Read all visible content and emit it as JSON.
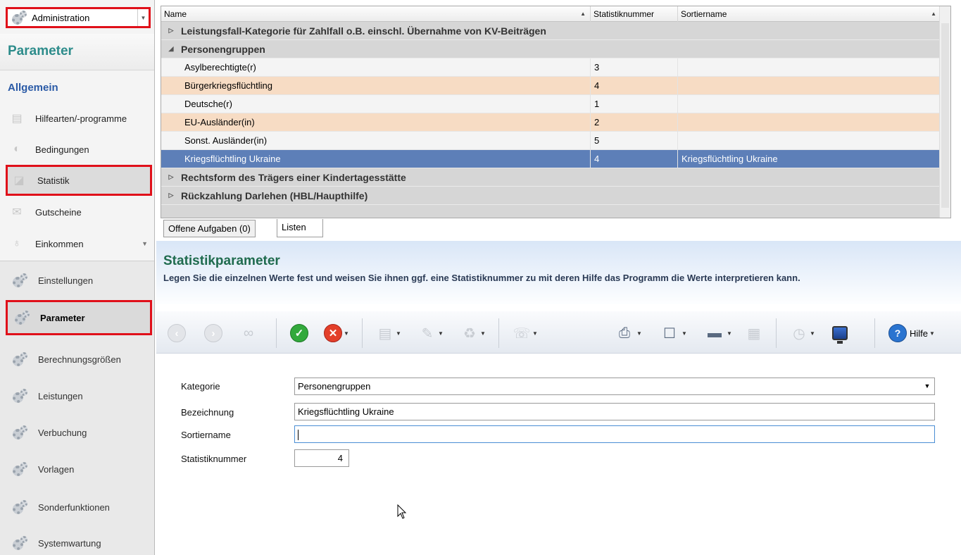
{
  "sidebar": {
    "module": "Administration",
    "header": "Parameter",
    "section": "Allgemein",
    "items": [
      {
        "label": "Hilfearten/-programme",
        "icon": "document-stack-icon"
      },
      {
        "label": "Bedingungen",
        "icon": "toggle-icon"
      },
      {
        "label": "Statistik",
        "icon": "chart-icon"
      },
      {
        "label": "Gutscheine",
        "icon": "voucher-icon"
      },
      {
        "label": "Einkommen",
        "icon": "money-bag-icon"
      }
    ],
    "groups": [
      {
        "label": "Einstellungen"
      },
      {
        "label": "Parameter"
      },
      {
        "label": "Berechnungsgrößen"
      },
      {
        "label": "Leistungen"
      },
      {
        "label": "Verbuchung"
      },
      {
        "label": "Vorlagen"
      },
      {
        "label": "Sonderfunktionen"
      },
      {
        "label": "Systemwartung"
      }
    ]
  },
  "grid": {
    "columns": [
      "Name",
      "Statistiknummer",
      "Sortiername"
    ],
    "group1": "Leistungsfall-Kategorie für Zahlfall o.B. einschl. Übernahme von KV-Beiträgen",
    "group2": "Personengruppen",
    "rows": [
      {
        "name": "Asylberechtigte(r)",
        "nr": "3",
        "sort": ""
      },
      {
        "name": "Bürgerkriegsflüchtling",
        "nr": "4",
        "sort": ""
      },
      {
        "name": "Deutsche(r)",
        "nr": "1",
        "sort": ""
      },
      {
        "name": "EU-Ausländer(in)",
        "nr": "2",
        "sort": ""
      },
      {
        "name": "Sonst. Ausländer(in)",
        "nr": "5",
        "sort": ""
      },
      {
        "name": "Kriegsflüchtling Ukraine",
        "nr": "4",
        "sort": "Kriegsflüchtling Ukraine"
      }
    ],
    "group3": "Rechtsform des Trägers einer Kindertagesstätte",
    "group4": "Rückzahlung Darlehen (HBL/Haupthilfe)"
  },
  "tabs": [
    "Offene Aufgaben (0)",
    "Listen"
  ],
  "detail": {
    "title": "Statistikparameter",
    "description": "Legen Sie die einzelnen Werte fest und weisen Sie ihnen ggf. eine Statistiknummer zu mit deren Hilfe das Programm die Werte interpretieren kann.",
    "hilfe": "Hilfe",
    "form": {
      "kategorie_label": "Kategorie",
      "kategorie_value": "Personengruppen",
      "bezeichnung_label": "Bezeichnung",
      "bezeichnung_value": "Kriegsflüchtling Ukraine",
      "sortiername_label": "Sortiername",
      "sortiername_value": "",
      "statistiknummer_label": "Statistiknummer",
      "statistiknummer_value": "4"
    }
  },
  "colors": {
    "highlight_red": "#e0101a",
    "selected_row": "#5d7fb8",
    "alt_row": "#f7dcc4",
    "title_green": "#1f6b4e"
  }
}
